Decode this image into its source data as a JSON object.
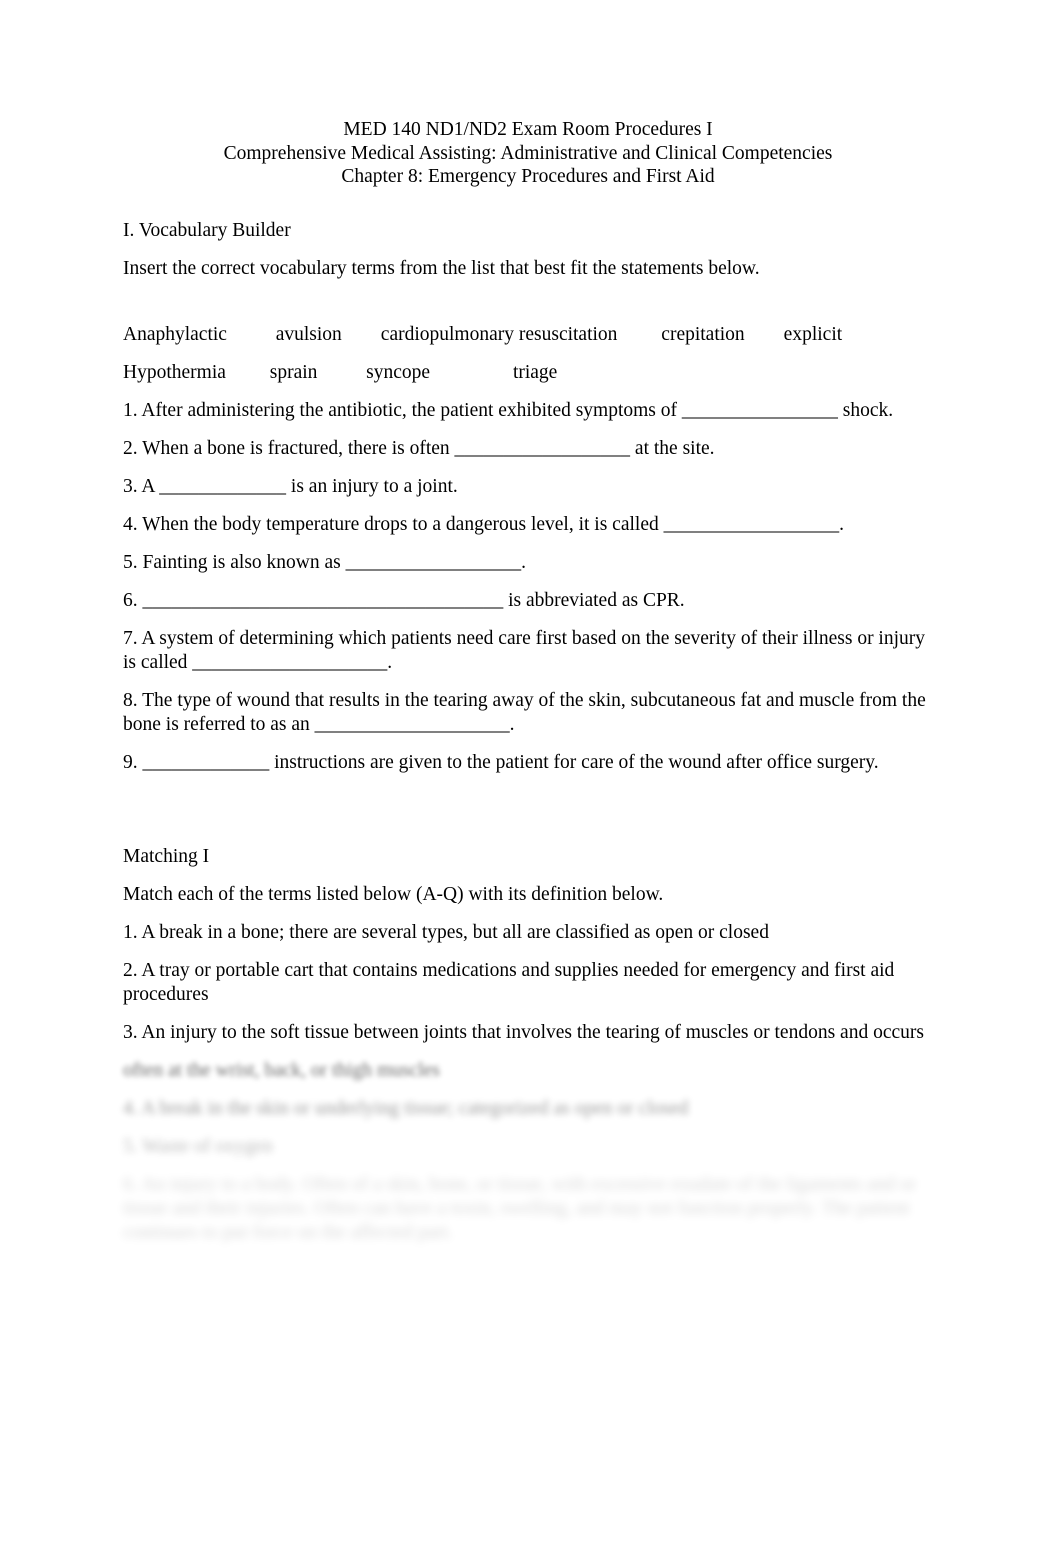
{
  "document": {
    "title_lines": [
      "MED 140 ND1/ND2 Exam Room Procedures I",
      "Comprehensive Medical Assisting: Administrative and Clinical Competencies",
      "Chapter 8: Emergency Procedures and First Aid"
    ]
  },
  "section_vocabulary": {
    "heading": "I. Vocabulary Builder",
    "instruction": "Insert the correct vocabulary terms from the list that best fit the statements below.",
    "word_bank_row_1": "Anaphylactic          avulsion        cardiopulmonary resuscitation         crepitation        explicit",
    "word_bank_row_2": "Hypothermia         sprain          syncope                 triage",
    "word_bank_terms": [
      "Anaphylactic",
      "avulsion",
      "cardiopulmonary resuscitation",
      "crepitation",
      "explicit",
      "Hypothermia",
      "sprain",
      "syncope",
      "triage"
    ],
    "items": [
      "1. After administering the antibiotic, the patient exhibited symptoms of ________________ shock.",
      "2. When a bone is fractured, there is often __________________ at the site.",
      "3. A _____________ is an injury to a joint.",
      "4. When the body temperature drops to a dangerous level, it is called __________________.",
      "5. Fainting is also known as __________________.",
      "6. _____________________________________ is abbreviated as CPR.",
      "7. A system of determining which patients need care first based on the severity of their illness or injury is called ____________________.",
      "8. The type of wound that results in the tearing away of the skin, subcutaneous fat and muscle from the bone is referred to as an ____________________.",
      "9. _____________ instructions are given to the patient for care of the wound after office surgery."
    ]
  },
  "section_matching": {
    "heading": "Matching I",
    "instruction": "Match each of the terms listed below (A-Q) with its definition below.",
    "items": [
      "1. A break in a bone; there are several types, but all are classified as open or closed",
      "2. A tray or portable cart that contains medications and supplies needed for emergency and first aid procedures",
      "3. An injury to the soft tissue between joints that involves the tearing of muscles or tendons and occurs"
    ],
    "obscured_items": [
      "often at the wrist, back, or thigh muscles",
      "4. A break in the skin or underlying tissue; categorized as open or closed",
      "5. Waste of oxygen",
      "6. An injury to a body. Often of a skin, bone, or tissue, with excessive exudate of the ligaments and or tissue and their injuries. Often can have a toxin, swelling, and may not function properly. The patient continues to put force on the affected part."
    ]
  }
}
